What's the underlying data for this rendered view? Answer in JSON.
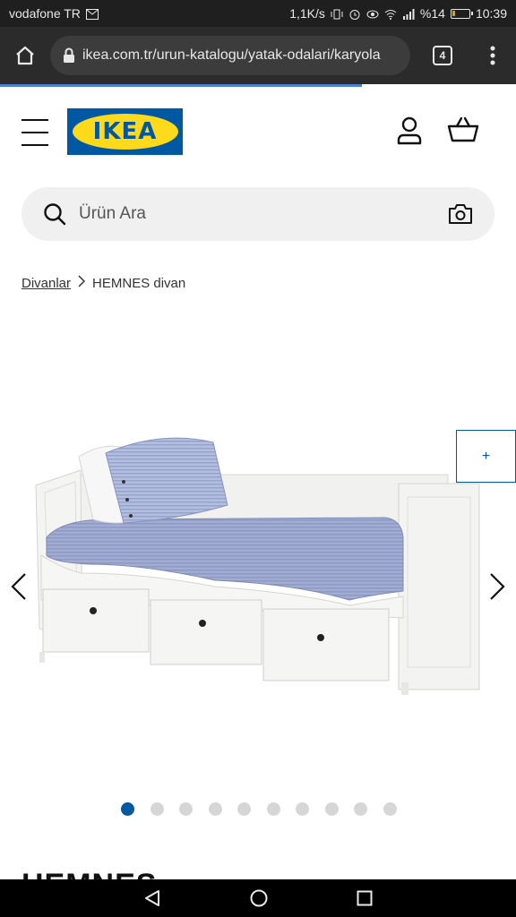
{
  "status_bar": {
    "carrier": "vodafone TR",
    "speed": "1,1K/s",
    "battery": "%14",
    "time": "10:39"
  },
  "browser": {
    "url": "ikea.com.tr/urun-katalogu/yatak-odalari/karyola",
    "tab_count": "4"
  },
  "header": {
    "logo_text": "IKEA"
  },
  "search": {
    "placeholder": "Ürün Ara"
  },
  "breadcrumb": {
    "items": [
      "Divanlar",
      "HEMNES divan"
    ],
    "separator": ">"
  },
  "gallery": {
    "hotspot_label": "+",
    "dot_count": 10,
    "active_dot": 0
  },
  "product": {
    "title": "HEMNES"
  },
  "colors": {
    "brand_blue": "#0058a3",
    "brand_yellow": "#ffda1a",
    "bedding": "#8d99c2"
  }
}
